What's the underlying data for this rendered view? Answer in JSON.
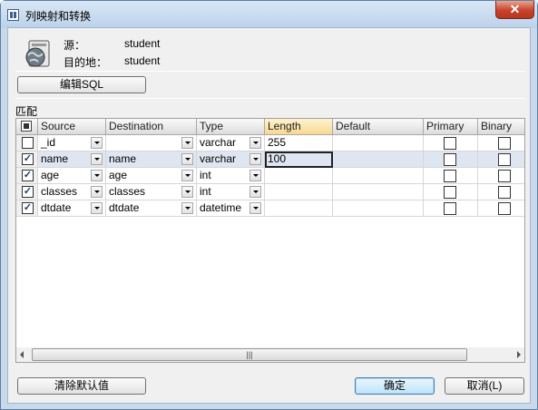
{
  "window": {
    "title": "列映射和转换",
    "close_glyph": "✕"
  },
  "info": {
    "source_label": "源：",
    "source_value": "student",
    "target_label": "目的地：",
    "target_value": "student"
  },
  "edit_sql_button": "编辑SQL",
  "group_label": "匹配",
  "grid": {
    "columns": [
      "Source",
      "Destination",
      "Type",
      "Length",
      "Default",
      "Primary",
      "Binary"
    ],
    "active_column": "Length",
    "rows": [
      {
        "checked": false,
        "source": "_id",
        "destination": "",
        "type": "varchar",
        "length": "255",
        "default": "",
        "primary": false,
        "binary": false
      },
      {
        "checked": true,
        "source": "name",
        "destination": "name",
        "type": "varchar",
        "length": "100",
        "default": "",
        "primary": false,
        "binary": false
      },
      {
        "checked": true,
        "source": "age",
        "destination": "age",
        "type": "int",
        "length": "",
        "default": "",
        "primary": false,
        "binary": false
      },
      {
        "checked": true,
        "source": "classes",
        "destination": "classes",
        "type": "int",
        "length": "",
        "default": "",
        "primary": false,
        "binary": false
      },
      {
        "checked": true,
        "source": "dtdate",
        "destination": "dtdate",
        "type": "datetime",
        "length": "",
        "default": "",
        "primary": false,
        "binary": false
      }
    ],
    "selected_row": 1,
    "scroll_thumb_glyph": "|||"
  },
  "buttons": {
    "clear_defaults": "清除默认值",
    "ok": "确定",
    "cancel": "取消(L)"
  },
  "colors": {
    "titlebar": "#c8d9ea",
    "close_button": "#c7432c",
    "active_header": "#f8d890",
    "selected_row": "#dfe6f2"
  }
}
